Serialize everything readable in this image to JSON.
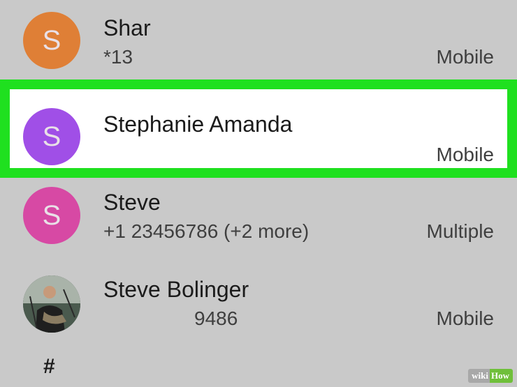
{
  "contacts": [
    {
      "initial": "S",
      "name": "Shar",
      "number": "*13",
      "type": "Mobile",
      "avatar_color": "#df7f36",
      "selected": false
    },
    {
      "initial": "S",
      "name": "Stephanie Amanda",
      "number": "",
      "type": "Mobile",
      "avatar_color": "#a04fe7",
      "selected": true
    },
    {
      "initial": "S",
      "name": "Steve",
      "number": "+1 23456786 (+2 more)",
      "type": "Multiple",
      "avatar_color": "#d749a4",
      "selected": false
    },
    {
      "initial": "",
      "name": "Steve Bolinger",
      "number": "9486",
      "type": "Mobile",
      "avatar_icon": "photo-avatar",
      "selected": false
    }
  ],
  "section_header": "#",
  "watermark": {
    "wiki": "wiki",
    "how": "How"
  },
  "colors": {
    "background": "#c9c9c9",
    "highlight_border": "#1fe01f",
    "selected_row_background": "#ffffff"
  }
}
